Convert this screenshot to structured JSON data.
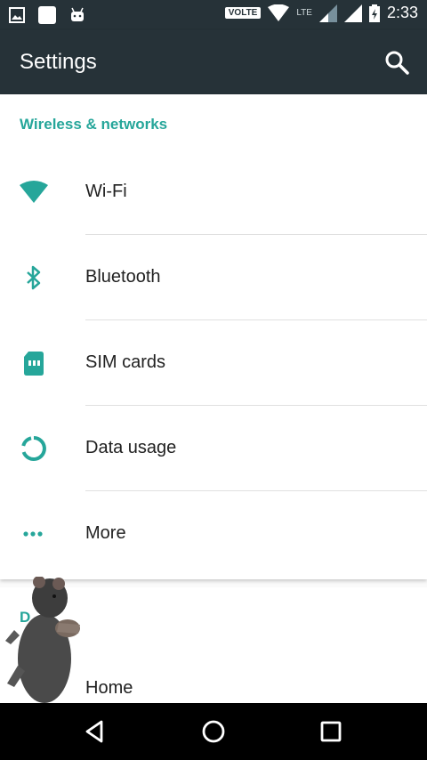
{
  "status_bar": {
    "volte": "VOLTE",
    "lte": "LTE",
    "time": "2:33"
  },
  "app_bar": {
    "title": "Settings",
    "search_icon": "search-icon"
  },
  "sections": {
    "wireless": {
      "header": "Wireless & networks",
      "items": [
        {
          "label": "Wi-Fi",
          "icon": "wifi-icon"
        },
        {
          "label": "Bluetooth",
          "icon": "bluetooth-icon"
        },
        {
          "label": "SIM cards",
          "icon": "sim-card-icon"
        },
        {
          "label": "Data usage",
          "icon": "data-usage-icon"
        },
        {
          "label": "More",
          "icon": "more-icon"
        }
      ]
    },
    "device": {
      "header": "D",
      "items": [
        {
          "label": "Home",
          "icon": "home-icon"
        }
      ]
    }
  },
  "colors": {
    "accent": "#26a69a",
    "app_bar": "#263238",
    "nav_bar": "#000000"
  }
}
